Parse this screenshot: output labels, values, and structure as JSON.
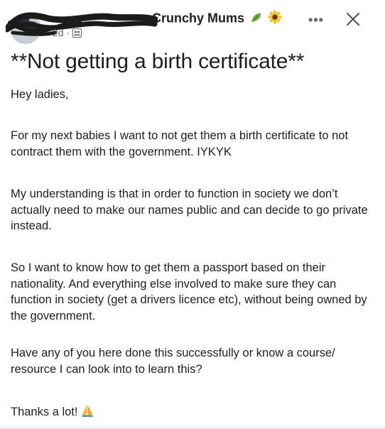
{
  "post": {
    "group_name": "Crunchy Mums",
    "time": "2d",
    "separator": "·",
    "title": "**Not getting a birth certificate**",
    "paragraphs": [
      "Hey ladies,",
      "For my next babies I want to not get them a birth certificate to not contract them with the government. IYKYK",
      "My understanding is that in order to function in society we don’t actually need to make our names public and can decide to go private instead.",
      "So I want to know how to get them a passport based on their nationality. And everything else involved to make sure they can function in society (get a drivers licence etc), without being owned by the government.",
      "Have any of you here done this successfully or know a course/ resource I can look into to learn this?",
      "Thanks a lot!"
    ]
  },
  "toolbar": {
    "more_label": "•••"
  },
  "icons": {
    "leaf": "leaf-icon",
    "sunflower": "sunflower-icon",
    "audience": "group-audience-icon",
    "more": "more-icon",
    "close": "close-icon",
    "pray": "folded-hands-icon"
  },
  "colors": {
    "text": "#1c1e21",
    "meta": "#65676b",
    "redaction": "#1b1b1b"
  }
}
